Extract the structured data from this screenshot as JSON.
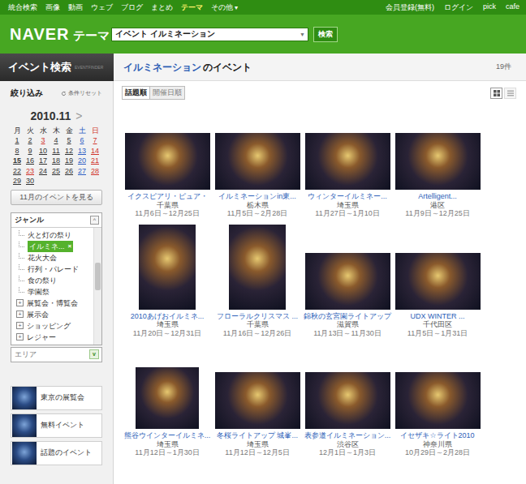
{
  "top_nav": {
    "links": [
      {
        "label": "統合検索",
        "selected": false
      },
      {
        "label": "画像",
        "selected": false
      },
      {
        "label": "動画",
        "selected": false
      },
      {
        "label": "ウェブ",
        "selected": false
      },
      {
        "label": "ブログ",
        "selected": false
      },
      {
        "label": "まとめ",
        "selected": false
      },
      {
        "label": "テーマ",
        "selected": true
      },
      {
        "label": "その他",
        "selected": false
      }
    ],
    "more_icon": "▾",
    "account_links": [
      "会員登録(無料)",
      "ログイン",
      "pick",
      "cafe"
    ]
  },
  "header": {
    "logo": "NAVER",
    "service": "テーマ",
    "search": {
      "value": "イベント イルミネーション",
      "dropdown_icon": "▼"
    },
    "search_button": "検索"
  },
  "sidebar": {
    "title": "イベント検索",
    "subtitle": "EVENTFINDER",
    "filter_label": "絞り込み",
    "reset_label": "条件リセット",
    "calendar": {
      "month": "2010.11",
      "next_icon": ">",
      "weekdays": [
        {
          "label": "月",
          "color": "#333333"
        },
        {
          "label": "火",
          "color": "#333333"
        },
        {
          "label": "水",
          "color": "#333333"
        },
        {
          "label": "木",
          "color": "#333333"
        },
        {
          "label": "金",
          "color": "#333333"
        },
        {
          "label": "土",
          "color": "#2f5fc4"
        },
        {
          "label": "日",
          "color": "#d0342c"
        }
      ],
      "days": [
        {
          "label": "1",
          "color": "#333333",
          "today": false
        },
        {
          "label": "2",
          "color": "#333333",
          "today": false
        },
        {
          "label": "3",
          "color": "#d0342c",
          "today": false
        },
        {
          "label": "4",
          "color": "#333333",
          "today": false
        },
        {
          "label": "5",
          "color": "#333333",
          "today": false
        },
        {
          "label": "6",
          "color": "#2f5fc4",
          "today": false
        },
        {
          "label": "7",
          "color": "#d0342c",
          "today": false
        },
        {
          "label": "8",
          "color": "#333333",
          "today": false
        },
        {
          "label": "9",
          "color": "#333333",
          "today": false
        },
        {
          "label": "10",
          "color": "#333333",
          "today": false
        },
        {
          "label": "11",
          "color": "#333333",
          "today": false
        },
        {
          "label": "12",
          "color": "#333333",
          "today": false
        },
        {
          "label": "13",
          "color": "#2f5fc4",
          "today": false
        },
        {
          "label": "14",
          "color": "#d0342c",
          "today": false
        },
        {
          "label": "15",
          "color": "#333333",
          "today": true
        },
        {
          "label": "16",
          "color": "#333333",
          "today": false
        },
        {
          "label": "17",
          "color": "#333333",
          "today": false
        },
        {
          "label": "18",
          "color": "#333333",
          "today": false
        },
        {
          "label": "19",
          "color": "#333333",
          "today": false
        },
        {
          "label": "20",
          "color": "#2f5fc4",
          "today": false
        },
        {
          "label": "21",
          "color": "#d0342c",
          "today": false
        },
        {
          "label": "22",
          "color": "#333333",
          "today": false
        },
        {
          "label": "23",
          "color": "#d0342c",
          "today": false
        },
        {
          "label": "24",
          "color": "#333333",
          "today": false
        },
        {
          "label": "25",
          "color": "#333333",
          "today": false
        },
        {
          "label": "26",
          "color": "#333333",
          "today": false
        },
        {
          "label": "27",
          "color": "#2f5fc4",
          "today": false
        },
        {
          "label": "28",
          "color": "#d0342c",
          "today": false
        },
        {
          "label": "29",
          "color": "#333333",
          "today": false
        },
        {
          "label": "30",
          "color": "#333333",
          "today": false
        }
      ]
    },
    "month_button": "11月のイベントを見る",
    "genre": {
      "title": "ジャンル",
      "expanded": true,
      "toggle_icon": "^",
      "scroll_level": 0.3,
      "items": [
        {
          "label": "火と灯の祭り",
          "kind": "leaf",
          "selected": false,
          "expanded": false,
          "icon": ""
        },
        {
          "label": "イルミネ...",
          "kind": "leaf",
          "selected": true,
          "expanded": false,
          "icon": "×"
        },
        {
          "label": "花火大会",
          "kind": "leaf",
          "selected": false,
          "expanded": false,
          "icon": ""
        },
        {
          "label": "行列・パレード",
          "kind": "leaf",
          "selected": false,
          "expanded": false,
          "icon": ""
        },
        {
          "label": "食の祭り",
          "kind": "leaf",
          "selected": false,
          "expanded": false,
          "icon": ""
        },
        {
          "label": "学園祭",
          "kind": "leaf",
          "selected": false,
          "expanded": false,
          "icon": ""
        },
        {
          "label": "展覧会・博覧会",
          "kind": "group",
          "selected": false,
          "expanded": false,
          "icon": "+"
        },
        {
          "label": "展示会",
          "kind": "group",
          "selected": false,
          "expanded": false,
          "icon": "+"
        },
        {
          "label": "ショッピング",
          "kind": "group",
          "selected": false,
          "expanded": false,
          "icon": "+"
        },
        {
          "label": "レジャー",
          "kind": "group",
          "selected": false,
          "expanded": false,
          "icon": "+"
        }
      ]
    },
    "area": {
      "label": "エリア",
      "expanded": false,
      "toggle_icon": "v"
    },
    "links": [
      {
        "label": "東京の展覧会"
      },
      {
        "label": "無料イベント"
      },
      {
        "label": "話題のイベント"
      }
    ]
  },
  "results": {
    "keyword": "イルミネーション",
    "suffix": "のイベント",
    "count": "19件",
    "sort_options": [
      {
        "label": "話題順",
        "selected": true
      },
      {
        "label": "開催日順",
        "selected": false
      }
    ],
    "views": [
      {
        "kind": "grid",
        "selected": true
      },
      {
        "kind": "list",
        "selected": false
      }
    ],
    "events": [
      {
        "title": "イクスピアリ・ピュア・",
        "place": "千葉県",
        "period": "11月6日～12月25日",
        "kind": "landscape"
      },
      {
        "title": "イルミネーションin東...",
        "place": "栃木県",
        "period": "11月5日～2月28日",
        "kind": "landscape"
      },
      {
        "title": "ウィンターイルミネー...",
        "place": "埼玉県",
        "period": "11月27日～1月10日",
        "kind": "landscape"
      },
      {
        "title": "Artelligent...",
        "place": "港区",
        "period": "11月9日～12月25日",
        "kind": "landscape"
      },
      {
        "title": "2010あげおイルミネ...",
        "place": "埼玉県",
        "period": "11月20日～12月31日",
        "kind": "portrait"
      },
      {
        "title": "フローラルクリスマス ...",
        "place": "千葉県",
        "period": "11月16日～12月26日",
        "kind": "portrait"
      },
      {
        "title": "錦秋の玄宮園ライトアップ",
        "place": "滋賀県",
        "period": "11月13日～11月30日",
        "kind": "landscape"
      },
      {
        "title": "UDX WINTER ...",
        "place": "千代田区",
        "period": "11月5日～1月31日",
        "kind": "landscape"
      },
      {
        "title": "熊谷ウインターイルミネ...",
        "place": "埼玉県",
        "period": "11月12日～1月30日",
        "kind": "square"
      },
      {
        "title": "冬桜ライトアップ 城峯...",
        "place": "埼玉県",
        "period": "11月12日～12月5日",
        "kind": "landscape"
      },
      {
        "title": "表参道イルミネーション...",
        "place": "渋谷区",
        "period": "12月1日～1月3日",
        "kind": "landscape"
      },
      {
        "title": "イセザキ☆ライト2010",
        "place": "神奈川県",
        "period": "10月29日～2月28日",
        "kind": "landscape"
      }
    ]
  }
}
